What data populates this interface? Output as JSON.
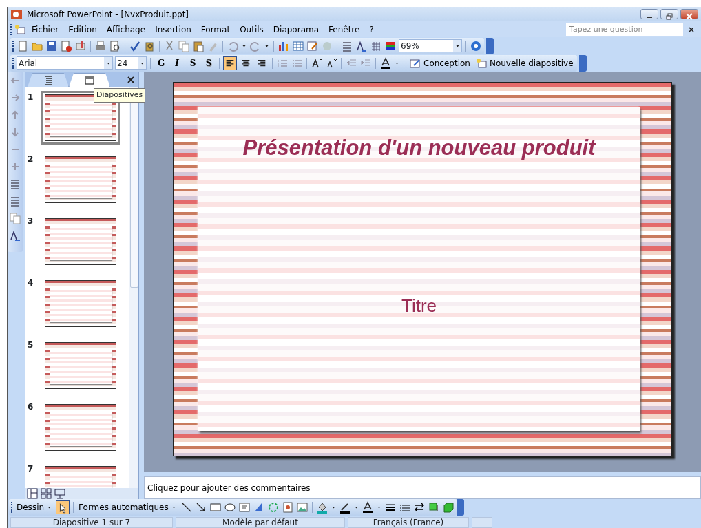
{
  "window": {
    "title": "Microsoft PowerPoint - [NvxProduit.ppt]"
  },
  "menu": [
    {
      "label": "Fichier"
    },
    {
      "label": "Edition"
    },
    {
      "label": "Affichage"
    },
    {
      "label": "Insertion"
    },
    {
      "label": "Format"
    },
    {
      "label": "Outils"
    },
    {
      "label": "Diaporama"
    },
    {
      "label": "Fenêtre"
    },
    {
      "label": "?"
    }
  ],
  "help_box": {
    "placeholder": "Tapez une question"
  },
  "standard_toolbar": {
    "zoom": "69%"
  },
  "format_toolbar": {
    "font": "Arial",
    "size": "24",
    "style_buttons": [
      {
        "label": "G",
        "kind": "bold"
      },
      {
        "label": "I",
        "kind": "italic"
      },
      {
        "label": "S",
        "kind": "underline"
      },
      {
        "label": "S",
        "kind": "shadow"
      }
    ],
    "align_buttons": [
      {
        "kind": "left",
        "selected": true
      },
      {
        "kind": "center",
        "selected": false
      },
      {
        "kind": "right",
        "selected": false
      }
    ],
    "design_button": "Conception",
    "new_slide_button": "Nouvelle diapositive"
  },
  "pane_tabs": [
    {
      "kind": "outline",
      "selected": false
    },
    {
      "kind": "slides",
      "selected": true
    }
  ],
  "tooltip": "Diapositives",
  "thumbnails": [
    {
      "number": "1",
      "selected": true
    },
    {
      "number": "2",
      "selected": false
    },
    {
      "number": "3",
      "selected": false
    },
    {
      "number": "4",
      "selected": false
    },
    {
      "number": "5",
      "selected": false
    },
    {
      "number": "6",
      "selected": false
    },
    {
      "number": "7",
      "selected": false
    }
  ],
  "slide": {
    "title": "Présentation d'un nouveau produit",
    "subtitle": "Titre"
  },
  "notes": {
    "placeholder": "Cliquez pour ajouter des commentaires"
  },
  "drawing_toolbar": {
    "draw_menu": "Dessin",
    "autoshapes": "Formes automatiques",
    "pointer_selected": true
  },
  "status_bar": [
    "Diapositive 1 sur 7",
    "Modèle par défaut",
    "Français (France)"
  ]
}
